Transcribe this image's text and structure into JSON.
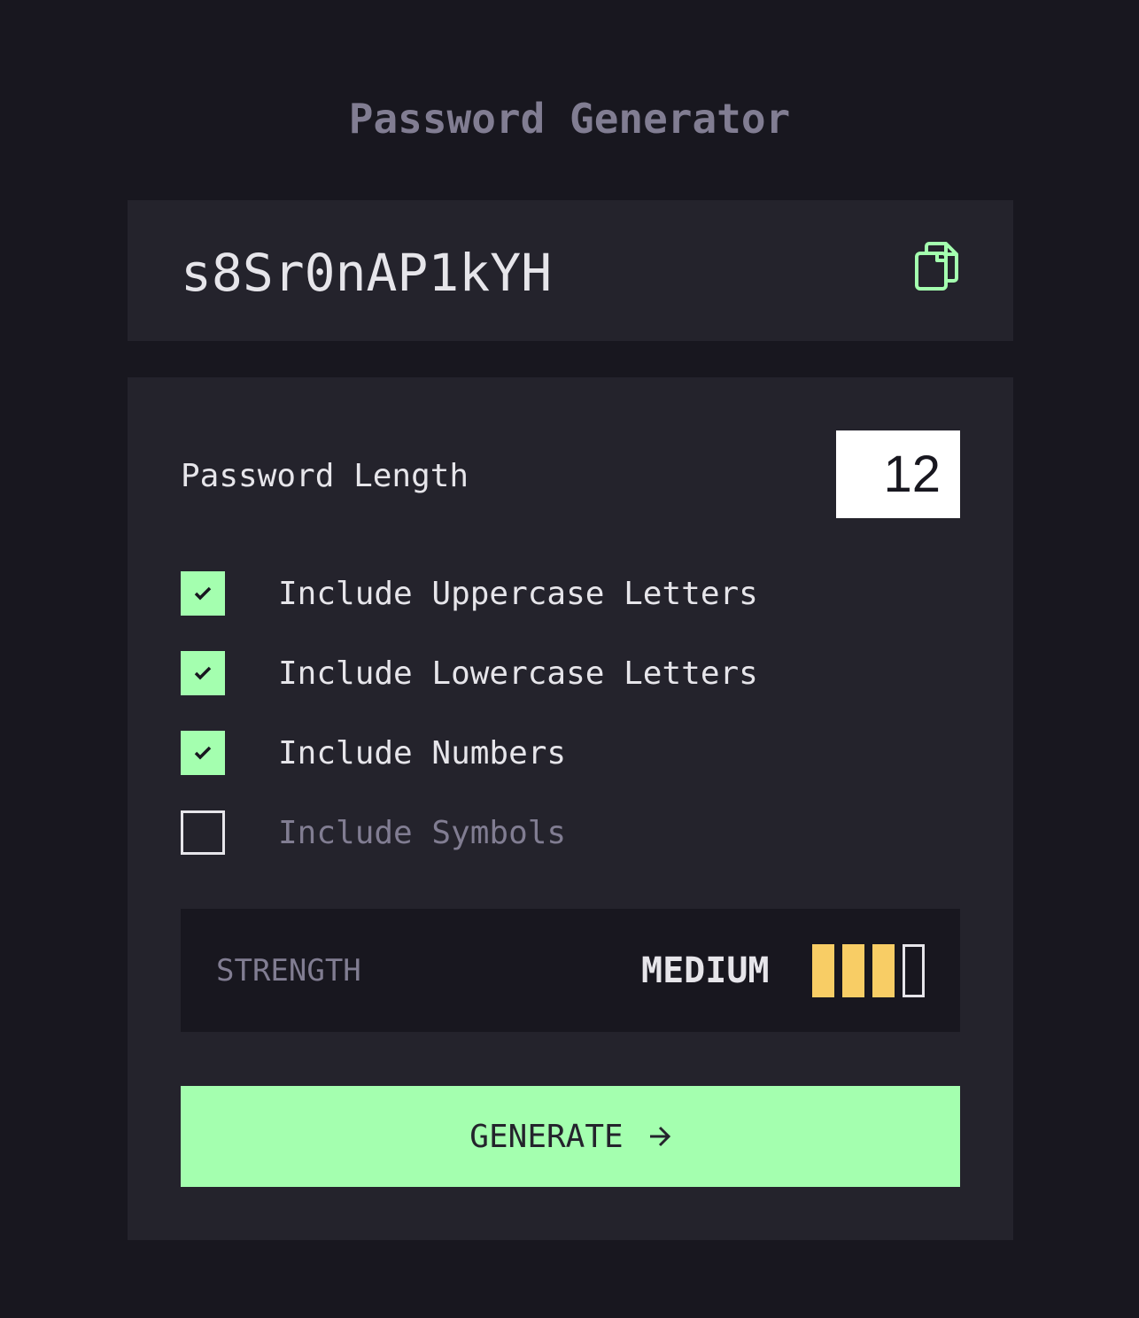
{
  "app": {
    "title": "Password Generator"
  },
  "password": {
    "value": "s8Sr0nAP1kYH",
    "copy_icon": "copy-icon"
  },
  "length": {
    "label": "Password Length",
    "value": "12"
  },
  "options": [
    {
      "label": "Include Uppercase Letters",
      "checked": true
    },
    {
      "label": "Include Lowercase Letters",
      "checked": true
    },
    {
      "label": "Include Numbers",
      "checked": true
    },
    {
      "label": "Include Symbols",
      "checked": false
    }
  ],
  "strength": {
    "label": "STRENGTH",
    "value": "MEDIUM",
    "bars_filled": 3,
    "bars_total": 4
  },
  "generate": {
    "label": "GENERATE",
    "icon": "arrow-right-icon"
  },
  "colors": {
    "background": "#18171f",
    "panel": "#24232c",
    "accent_green": "#a4ffaf",
    "strength_yellow": "#f8cd65",
    "text": "#e6e5ea",
    "muted": "#817d92"
  }
}
